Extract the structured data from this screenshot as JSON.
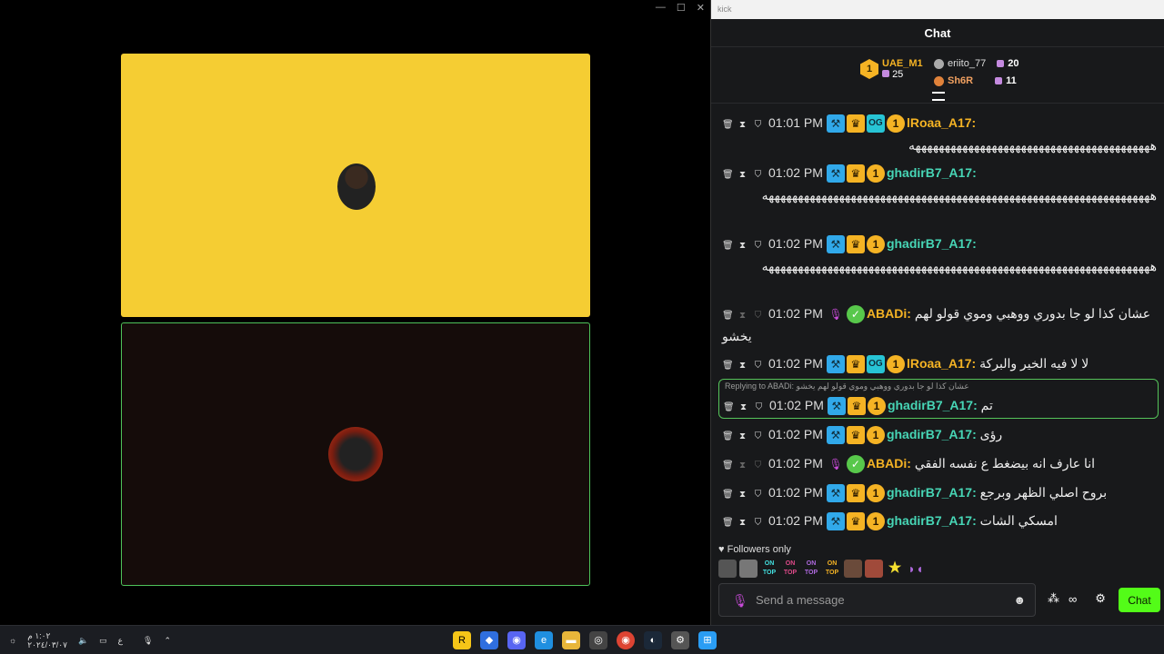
{
  "window": {
    "controls": [
      "—",
      "☐",
      "✕"
    ]
  },
  "browser": {
    "tab_title": "kick"
  },
  "chat": {
    "header": "Chat",
    "leaderboard": {
      "first": {
        "rank": "1",
        "name": "UAE_M1",
        "gifts": "25"
      },
      "second": {
        "name": "eriito_77",
        "gifts": "20"
      },
      "third": {
        "name": "Sh6R",
        "gifts": "11"
      }
    },
    "messages": [
      {
        "time": "01:01 PM",
        "user": "lRoaa_A17:",
        "text": "هههههههههههههههههههههههههههههههههههههههههه"
      },
      {
        "time": "01:02 PM",
        "user": "ghadirB7_A17:",
        "text": "ههههههههههههههههههههههههههههههههههههههههههههههههههههههههههههههههههه"
      },
      {
        "time": "01:02 PM",
        "user": "ghadirB7_A17:",
        "text": "ههههههههههههههههههههههههههههههههههههههههههههههههههههههههههههههههههه"
      },
      {
        "time": "01:02 PM",
        "user": "ABADi:",
        "text": "عشان كذا لو جا بدوري ووهبي وموي قولو لهم يخشو"
      },
      {
        "time": "01:02 PM",
        "user": "lRoaa_A17:",
        "text": "لا لا فيه الخير والبركة"
      },
      {
        "time": "01:02 PM",
        "user": "ghadirB7_A17:",
        "text": "تم",
        "reply": "Replying to ABADi: عشان كذا لو جا بدوري ووهبي وموي قولو لهم يخشو"
      },
      {
        "time": "01:02 PM",
        "user": "ghadirB7_A17:",
        "text": "رؤى"
      },
      {
        "time": "01:02 PM",
        "user": "ABADi:",
        "text": "انا عارف انه بيضغط ع نفسه الفقي"
      },
      {
        "time": "01:02 PM",
        "user": "ghadirB7_A17:",
        "text": "بروح اصلي الظهر وبرجع"
      },
      {
        "time": "01:02 PM",
        "user": "ghadirB7_A17:",
        "text": "امسكي الشات"
      }
    ],
    "followers_only": "Followers only",
    "emote_on_top": "ON TOP",
    "input": {
      "placeholder": "Send a message"
    },
    "infinity": "∞",
    "send_label": "Chat"
  },
  "taskbar": {
    "date": "٢٠٢٤/٠٣/٠٧",
    "time": "١:٠٢ م",
    "lang": "ع"
  },
  "colors": {
    "kick_green": "#53fc18",
    "gold": "#f5b324",
    "teal": "#47d6b6",
    "tile_yellow": "#f5cd33"
  }
}
